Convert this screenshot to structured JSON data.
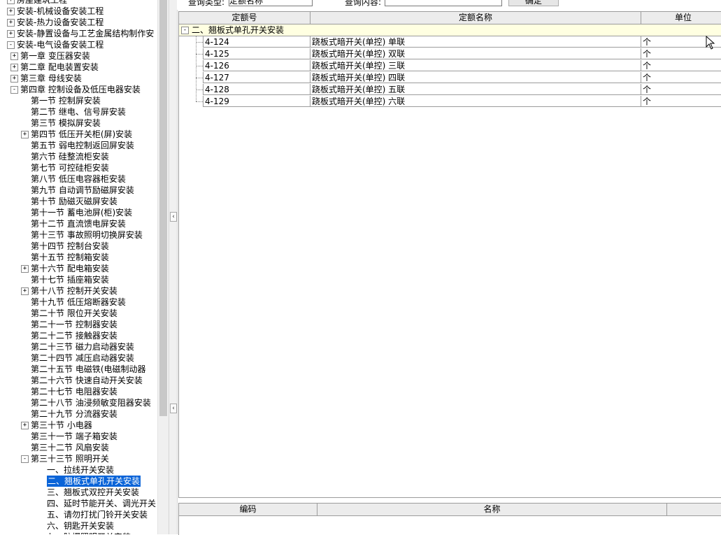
{
  "query_bar": {
    "type_label": "查询类型:",
    "type_value": "定额名称",
    "content_label": "查询内容:",
    "content_value": "",
    "confirm_label": "确定"
  },
  "tree": {
    "items": [
      {
        "label": "房屋建筑工程",
        "level": 0,
        "expander": "+"
      },
      {
        "label": "安装-机械设备安装工程",
        "level": 0,
        "expander": "+"
      },
      {
        "label": "安装-热力设备安装工程",
        "level": 0,
        "expander": "+"
      },
      {
        "label": "安装-静置设备与工艺金属结构制作安",
        "level": 0,
        "expander": "+"
      },
      {
        "label": "安装-电气设备安装工程",
        "level": 0,
        "expander": "-"
      },
      {
        "label": "第一章 变压器安装",
        "level": 1,
        "expander": "+"
      },
      {
        "label": "第二章 配电装置安装",
        "level": 1,
        "expander": "+"
      },
      {
        "label": "第三章 母线安装",
        "level": 1,
        "expander": "+"
      },
      {
        "label": "第四章 控制设备及低压电器安装",
        "level": 1,
        "expander": "-"
      },
      {
        "label": "第一节 控制屏安装",
        "level": 2,
        "expander": ""
      },
      {
        "label": "第二节 继电、信号屏安装",
        "level": 2,
        "expander": ""
      },
      {
        "label": "第三节 模拟屏安装",
        "level": 2,
        "expander": ""
      },
      {
        "label": "第四节 低压开关柜(屏)安装",
        "level": 2,
        "expander": "+"
      },
      {
        "label": "第五节 弱电控制返回屏安装",
        "level": 2,
        "expander": ""
      },
      {
        "label": "第六节 硅整流柜安装",
        "level": 2,
        "expander": ""
      },
      {
        "label": "第七节 可控硅柜安装",
        "level": 2,
        "expander": ""
      },
      {
        "label": "第八节 低压电容器柜安装",
        "level": 2,
        "expander": ""
      },
      {
        "label": "第九节 自动调节励磁屏安装",
        "level": 2,
        "expander": ""
      },
      {
        "label": "第十节 励磁灭磁屏安装",
        "level": 2,
        "expander": ""
      },
      {
        "label": "第十一节 蓄电池屏(柜)安装",
        "level": 2,
        "expander": ""
      },
      {
        "label": "第十二节 直流馈电屏安装",
        "level": 2,
        "expander": ""
      },
      {
        "label": "第十三节 事故照明切换屏安装",
        "level": 2,
        "expander": ""
      },
      {
        "label": "第十四节 控制台安装",
        "level": 2,
        "expander": ""
      },
      {
        "label": "第十五节 控制箱安装",
        "level": 2,
        "expander": ""
      },
      {
        "label": "第十六节 配电箱安装",
        "level": 2,
        "expander": "+"
      },
      {
        "label": "第十七节 插座箱安装",
        "level": 2,
        "expander": ""
      },
      {
        "label": "第十八节 控制开关安装",
        "level": 2,
        "expander": "+"
      },
      {
        "label": "第十九节 低压熔断器安装",
        "level": 2,
        "expander": ""
      },
      {
        "label": "第二十节 限位开关安装",
        "level": 2,
        "expander": ""
      },
      {
        "label": "第二十一节 控制器安装",
        "level": 2,
        "expander": ""
      },
      {
        "label": "第二十二节 接触器安装",
        "level": 2,
        "expander": ""
      },
      {
        "label": "第二十三节 磁力启动器安装",
        "level": 2,
        "expander": ""
      },
      {
        "label": "第二十四节 减压启动器安装",
        "level": 2,
        "expander": ""
      },
      {
        "label": "第二十五节 电磁铁(电磁制动器",
        "level": 2,
        "expander": ""
      },
      {
        "label": "第二十六节 快速自动开关安装",
        "level": 2,
        "expander": ""
      },
      {
        "label": "第二十七节 电阻器安装",
        "level": 2,
        "expander": ""
      },
      {
        "label": "第二十八节 油浸频敏变阻器安装",
        "level": 2,
        "expander": ""
      },
      {
        "label": "第二十九节 分流器安装",
        "level": 2,
        "expander": ""
      },
      {
        "label": "第三十节 小电器",
        "level": 2,
        "expander": "+"
      },
      {
        "label": "第三十一节 端子箱安装",
        "level": 2,
        "expander": ""
      },
      {
        "label": "第三十二节 风扇安装",
        "level": 2,
        "expander": ""
      },
      {
        "label": "第三十三节 照明开关",
        "level": 2,
        "expander": "-"
      },
      {
        "label": "一、拉线开关安装",
        "level": 3,
        "expander": ""
      },
      {
        "label": "二、翘板式单孔开关安装",
        "level": 3,
        "expander": "",
        "selected": true
      },
      {
        "label": "三、翘板式双控开关安装",
        "level": 3,
        "expander": ""
      },
      {
        "label": "四、延时节能开关、调光开关",
        "level": 3,
        "expander": ""
      },
      {
        "label": "五、请勿打扰门铃开关安装",
        "level": 3,
        "expander": ""
      },
      {
        "label": "六、钥匙开关安装",
        "level": 3,
        "expander": ""
      },
      {
        "label": "七、防爆照明开关安装",
        "level": 3,
        "expander": ""
      }
    ]
  },
  "grid_top": {
    "headers": [
      "定额号",
      "定额名称",
      "单位"
    ],
    "group_label": "二、翘板式单孔开关安装",
    "group_expander": "-",
    "rows": [
      {
        "code": "4-124",
        "name": "跷板式暗开关(单控) 单联",
        "unit": "个"
      },
      {
        "code": "4-125",
        "name": "跷板式暗开关(单控) 双联",
        "unit": "个"
      },
      {
        "code": "4-126",
        "name": "跷板式暗开关(单控) 三联",
        "unit": "个"
      },
      {
        "code": "4-127",
        "name": "跷板式暗开关(单控) 四联",
        "unit": "个"
      },
      {
        "code": "4-128",
        "name": "跷板式暗开关(单控) 五联",
        "unit": "个"
      },
      {
        "code": "4-129",
        "name": "跷板式暗开关(单控) 六联",
        "unit": "个"
      }
    ]
  },
  "grid_bottom": {
    "headers": [
      "编码",
      "名称",
      ""
    ]
  },
  "splitter": {
    "arrow_up": "‹",
    "arrow_down": "‹"
  },
  "colors": {
    "selection": "#0a64d8",
    "group_row": "#ffffe1",
    "header_bg": "#ececec"
  }
}
